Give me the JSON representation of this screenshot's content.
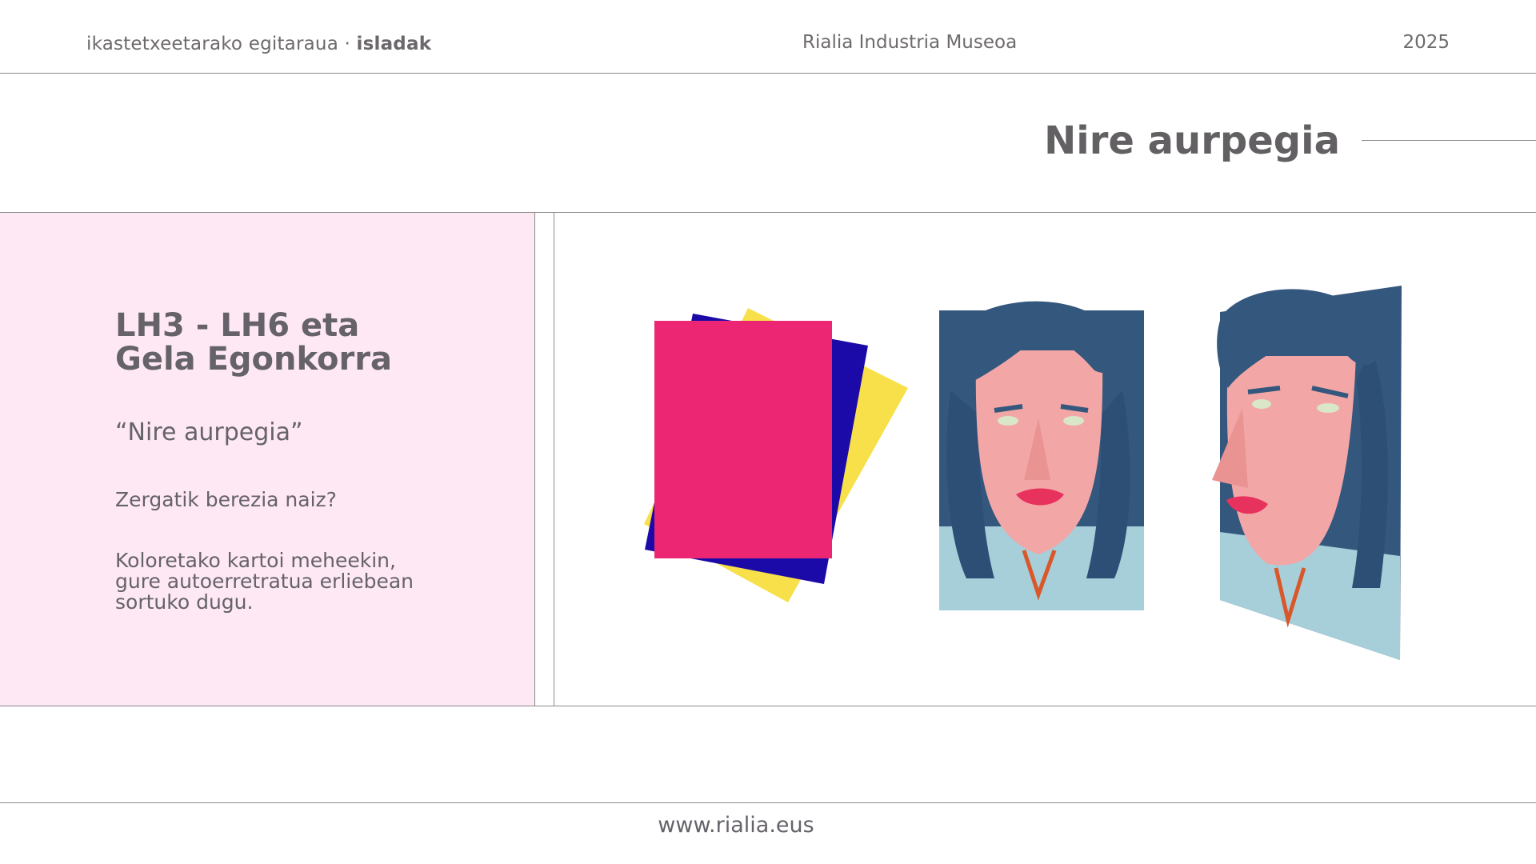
{
  "header": {
    "program": "ikastetxeetarako egitaraua · ",
    "program_bold": "isladak",
    "museum": "Rialia Industria Museoa",
    "year": "2025"
  },
  "slide": {
    "title": "Nire aurpegia"
  },
  "panel": {
    "level_line1": "LH3 - LH6 eta",
    "level_line2": "Gela Egonkorra",
    "quote": "“Nire aurpegia”",
    "question": "Zergatik berezia naiz?",
    "body_line1": "Koloretako kartoi meheekin,",
    "body_line2": "gure autoerretratua erliebean",
    "body_line3": "sortuko dugu."
  },
  "colors": {
    "pink_panel": "#fde8f4",
    "card_pink": "#ec2673",
    "card_blue": "#1c0aa8",
    "card_yellow": "#f7e04a",
    "hair_blue": "#34577e",
    "skin": "#f2a6a6",
    "lips": "#e8325e"
  },
  "footer": {
    "url": "www.rialia.eus"
  }
}
